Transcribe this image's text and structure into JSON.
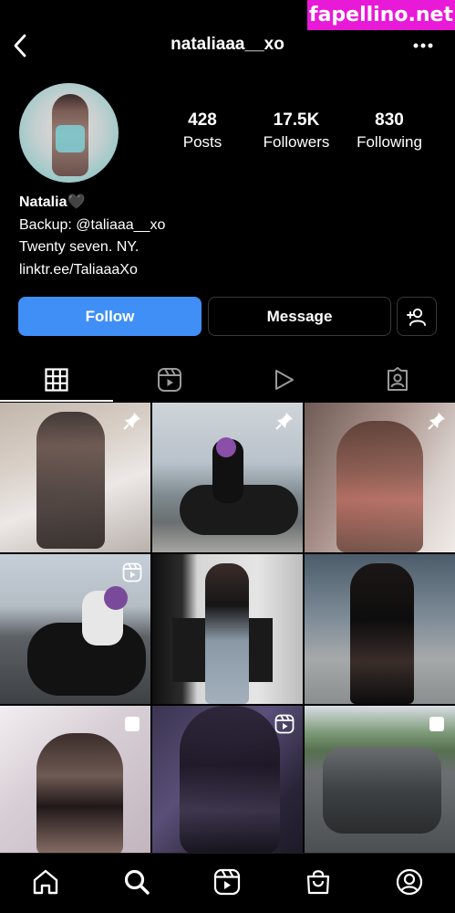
{
  "watermark": "fapellino.net",
  "header": {
    "username": "nataliaaa__xo"
  },
  "profile": {
    "stats": [
      {
        "value": "428",
        "label": "Posts"
      },
      {
        "value": "17.5K",
        "label": "Followers"
      },
      {
        "value": "830",
        "label": "Following"
      }
    ],
    "display_name": "Natalia🖤",
    "bio_lines": [
      "Backup: @taliaaa__xo",
      "Twenty seven. NY.",
      "linktr.ee/TaliaaaXo"
    ]
  },
  "actions": {
    "follow": "Follow",
    "message": "Message"
  },
  "tabs": [
    "posts-grid-icon",
    "reels-icon",
    "video-play-icon",
    "tagged-icon"
  ],
  "grid": {
    "cells": [
      {
        "badge": "pin-icon"
      },
      {
        "badge": "pin-icon"
      },
      {
        "badge": "pin-icon"
      },
      {
        "badge": "reels-icon"
      },
      {
        "badge": ""
      },
      {
        "badge": ""
      },
      {
        "badge": "multi-photo-icon"
      },
      {
        "badge": "reels-icon"
      },
      {
        "badge": "multi-photo-icon"
      }
    ]
  },
  "bottom_nav": [
    "home-icon",
    "search-icon",
    "reels-icon",
    "shop-icon",
    "profile-icon"
  ],
  "colors": {
    "accent": "#3f8ff7",
    "background": "#000000",
    "watermark": "#e819d7"
  }
}
